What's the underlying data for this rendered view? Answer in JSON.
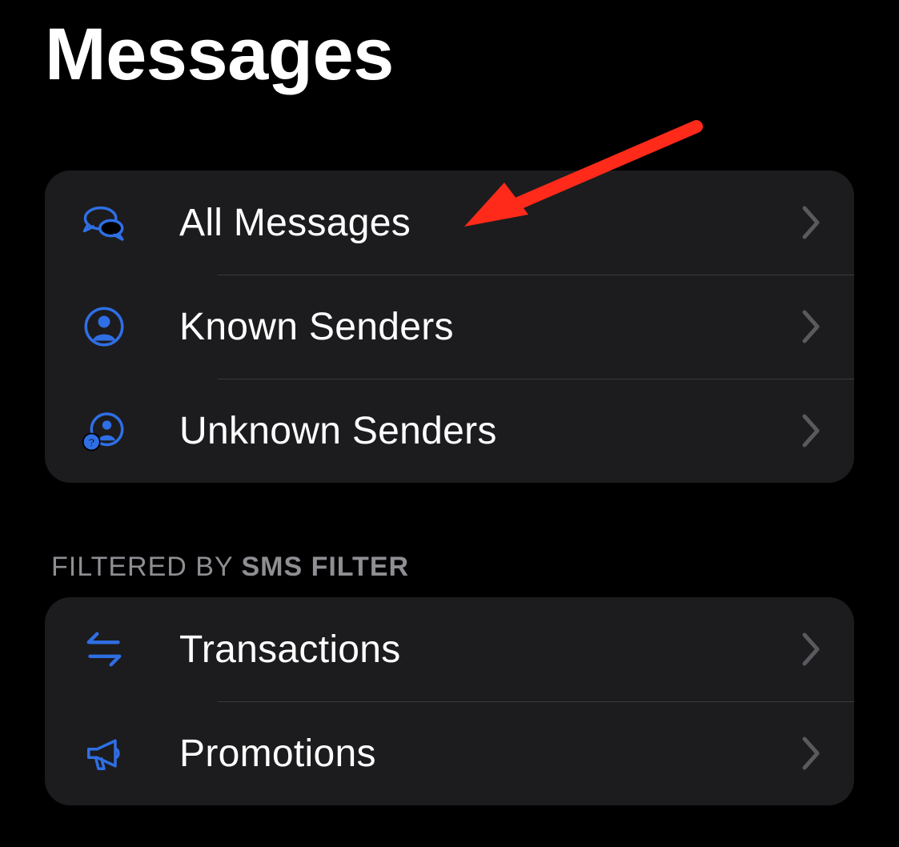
{
  "page_title": "Messages",
  "groups": [
    {
      "rows": [
        {
          "icon": "chat-bubbles-icon",
          "label": "All Messages"
        },
        {
          "icon": "person-circle-icon",
          "label": "Known Senders"
        },
        {
          "icon": "person-question-icon",
          "label": "Unknown Senders"
        }
      ]
    }
  ],
  "filtered_section": {
    "header_prefix": "Filtered by ",
    "header_app": "SMS Filter",
    "rows": [
      {
        "icon": "arrows-swap-icon",
        "label": "Transactions"
      },
      {
        "icon": "megaphone-icon",
        "label": "Promotions"
      }
    ]
  },
  "colors": {
    "accent": "#2f6fe5",
    "annotation": "#ff2a1a"
  }
}
